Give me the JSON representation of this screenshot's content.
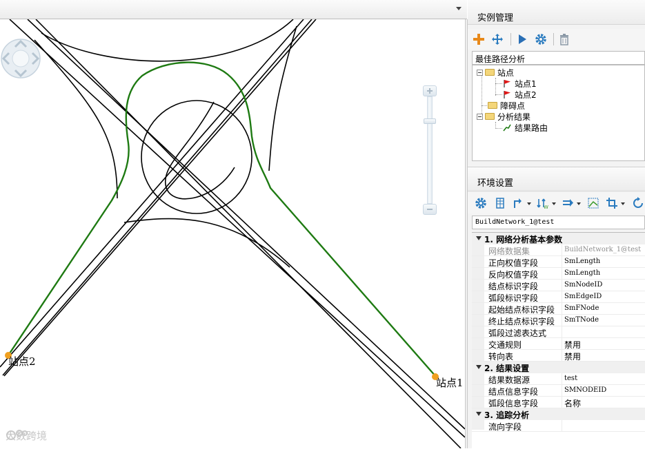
{
  "map": {
    "stations": [
      {
        "label": "站点2"
      },
      {
        "label": "站点1"
      }
    ],
    "watermark": "大数跨境"
  },
  "instance_panel": {
    "title": "实例管理",
    "toolbar_icons": [
      "add-icon",
      "move-icon",
      "run-icon",
      "settings-icon",
      "delete-icon"
    ],
    "analysis_type": "最佳路径分析",
    "tree": {
      "stations_label": "站点",
      "station_items": [
        "站点1",
        "站点2"
      ],
      "barriers_label": "障碍点",
      "results_label": "分析结果",
      "result_items": [
        "结果路由"
      ]
    }
  },
  "env_panel": {
    "title": "环境设置",
    "network": "BuildNetwork_1@test",
    "groups": [
      {
        "name": "1. 网络分析基本参数",
        "rows": [
          {
            "name": "网络数据集",
            "value": "BuildNetwork_1@test",
            "disabled": true
          },
          {
            "name": "正向权值字段",
            "value": "SmLength"
          },
          {
            "name": "反向权值字段",
            "value": "SmLength"
          },
          {
            "name": "结点标识字段",
            "value": "SmNodeID"
          },
          {
            "name": "弧段标识字段",
            "value": "SmEdgeID"
          },
          {
            "name": "起始结点标识字段",
            "value": "SmFNode"
          },
          {
            "name": "终止结点标识字段",
            "value": "SmTNode"
          },
          {
            "name": "弧段过滤表达式",
            "value": ""
          },
          {
            "name": "交通规则",
            "value": "禁用"
          },
          {
            "name": "转向表",
            "value": "禁用"
          }
        ]
      },
      {
        "name": "2. 结果设置",
        "rows": [
          {
            "name": "结果数据源",
            "value": "test"
          },
          {
            "name": "结点信息字段",
            "value": "SMNODEID"
          },
          {
            "name": "弧段信息字段",
            "value": "名称"
          }
        ]
      },
      {
        "name": "3. 追踪分析",
        "rows": [
          {
            "name": "流向字段",
            "value": ""
          }
        ]
      }
    ]
  },
  "colors": {
    "route": "#1e7a12",
    "road": "#000000",
    "station": "#f0a020",
    "add_icon": "#e8891a",
    "blue_icon": "#2a7bbf"
  }
}
